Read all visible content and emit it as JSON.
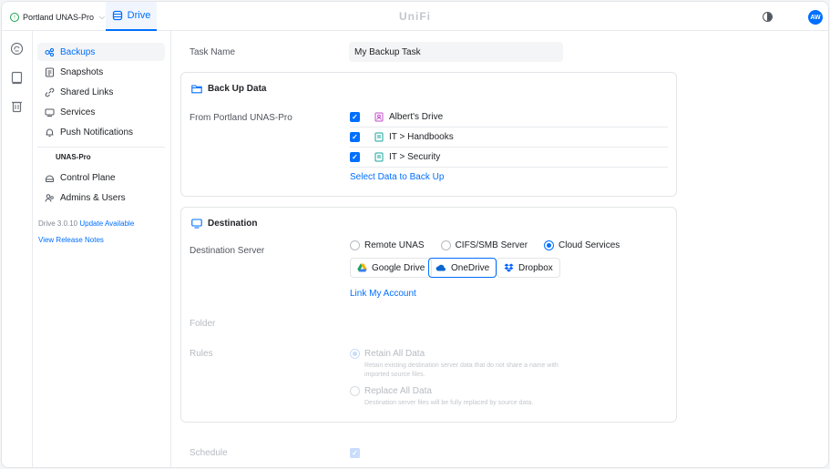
{
  "topbar": {
    "device_name": "Portland UNAS-Pro",
    "app_tab": "Drive",
    "brand": "UniFi",
    "avatar_initials": "AW"
  },
  "sidebar": {
    "items": [
      {
        "label": "Backups",
        "icon": "backup-icon",
        "active": true
      },
      {
        "label": "Snapshots",
        "icon": "snapshot-icon"
      },
      {
        "label": "Shared Links",
        "icon": "link-icon"
      },
      {
        "label": "Services",
        "icon": "services-icon"
      },
      {
        "label": "Push Notifications",
        "icon": "bell-icon"
      }
    ],
    "section_title": "UNAS-Pro",
    "section_items": [
      {
        "label": "Control Plane",
        "icon": "control-plane-icon"
      },
      {
        "label": "Admins & Users",
        "icon": "users-icon"
      }
    ],
    "version": "Drive 3.0.10",
    "update_link": "Update Available",
    "release_notes": "View Release Notes"
  },
  "form": {
    "task_name_label": "Task Name",
    "task_name_value": "My Backup Task",
    "backup_card": {
      "title": "Back Up Data",
      "source_label": "From Portland UNAS-Pro",
      "sources": [
        "Albert's Drive",
        "IT > Handbooks",
        "IT > Security"
      ],
      "select_link": "Select Data to Back Up"
    },
    "destination_card": {
      "title": "Destination",
      "server_label": "Destination Server",
      "server_options": [
        "Remote UNAS",
        "CIFS/SMB Server",
        "Cloud Services"
      ],
      "selected_server": "Cloud Services",
      "providers": [
        "Google Drive",
        "OneDrive",
        "Dropbox"
      ],
      "selected_provider": "OneDrive",
      "link_account": "Link My Account",
      "folder_label": "Folder",
      "rules_label": "Rules",
      "rules": [
        {
          "title": "Retain All Data",
          "desc": "Retain existing destination server data that do not share a name with imported source files.",
          "selected": true
        },
        {
          "title": "Replace All Data",
          "desc": "Destination server files will be fully replaced by source data.",
          "selected": false
        }
      ]
    },
    "schedule_label": "Schedule"
  },
  "colors": {
    "accent": "#006fff",
    "text": "#212327",
    "muted": "#50565e",
    "border": "#e3e5e8"
  }
}
